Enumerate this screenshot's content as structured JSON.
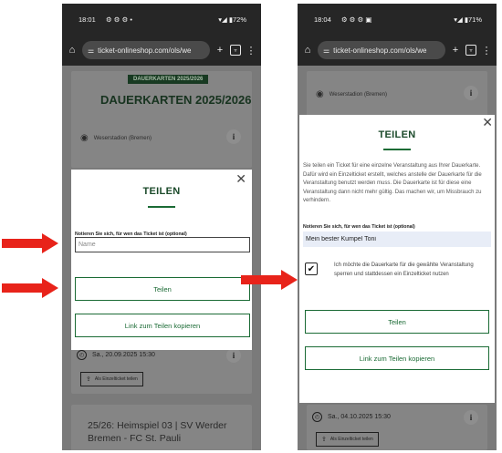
{
  "left": {
    "status": {
      "time": "18:01",
      "icons": "⚙ ⚙ ⚙ •",
      "battery": "▾◢ ▮72%"
    },
    "url": "ticket-onlineshop.com/ols/we",
    "page": {
      "pill": "DAUERKARTEN 2025/2026",
      "title": "DAUERKARTEN 2025/2026",
      "venue": "Weserstadion (Bremen)",
      "date": "Sa., 20.09.2025 15:30",
      "ticket_btn": "Als Einzelticket teilen",
      "match_title": "25/26: Heimspiel 03 | SV Werder Bremen - FC St. Pauli"
    },
    "modal": {
      "title": "TEILEN",
      "label": "Notieren Sie sich, für wen das Ticket ist (optional)",
      "placeholder": "Name",
      "share_btn": "Teilen",
      "copy_btn": "Link zum Teilen kopieren"
    }
  },
  "right": {
    "status": {
      "time": "18:04",
      "icons": "⚙ ⚙ ⚙ ▣",
      "battery": "▾◢ ▮71%"
    },
    "url": "ticket-onlineshop.com/ols/we",
    "page": {
      "venue": "Weserstadion (Bremen)",
      "date": "Sa., 04.10.2025 15:30",
      "ticket_btn": "Als Einzelticket teilen"
    },
    "modal": {
      "title": "TEILEN",
      "description": "Sie teilen ein Ticket für eine einzelne Veranstaltung aus Ihrer Dauerkarte. Dafür wird ein Einzelticket erstellt, welches anstelle der Dauerkarte für die Veranstaltung benutzt werden muss. Die Dauerkarte ist für diese eine Veranstaltung dann nicht mehr gültig. Das machen wir, um Missbrauch zu verhindern.",
      "label": "Notieren Sie sich, für wen das Ticket ist (optional)",
      "input_value": "Mein bester Kumpel Toni",
      "checkbox_label": "Ich möchte die Dauerkarte für die gewählte Veranstaltung sperren und stattdessen ein Einzelticket nutzen",
      "share_btn": "Teilen",
      "copy_btn": "Link zum Teilen kopieren"
    }
  },
  "colors": {
    "arrow": "#e8231a",
    "accent": "#1b6b35",
    "dark_green": "#183a22"
  }
}
